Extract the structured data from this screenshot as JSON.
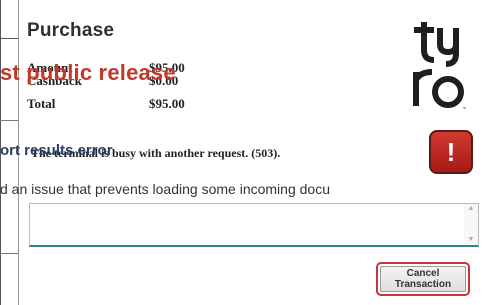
{
  "dialog": {
    "title": "Purchase",
    "rows": [
      {
        "label": "Amount",
        "value": "$95.00"
      },
      {
        "label": "Cashback",
        "value": "$0.00"
      },
      {
        "label": "Total",
        "value": "$95.00"
      }
    ],
    "message": "The terminal is busy with another request. (503).",
    "textarea_value": "",
    "cancel_line1": "Cancel",
    "cancel_line2": "Transaction"
  },
  "background_page": {
    "heading": "st public release",
    "subheading": "ort results error",
    "body_line": "d an issue that prevents loading some incoming docu"
  },
  "colors": {
    "logo": "#1f1f1f",
    "error": "#c0392b",
    "accent_border": "#2f7fa0",
    "cancel_border": "#c9353a",
    "bg_heading": "#c0392b",
    "bg_sub": "#2c3e66"
  },
  "icons": {
    "logo": "tyro-logo",
    "error": "exclamation-icon"
  }
}
